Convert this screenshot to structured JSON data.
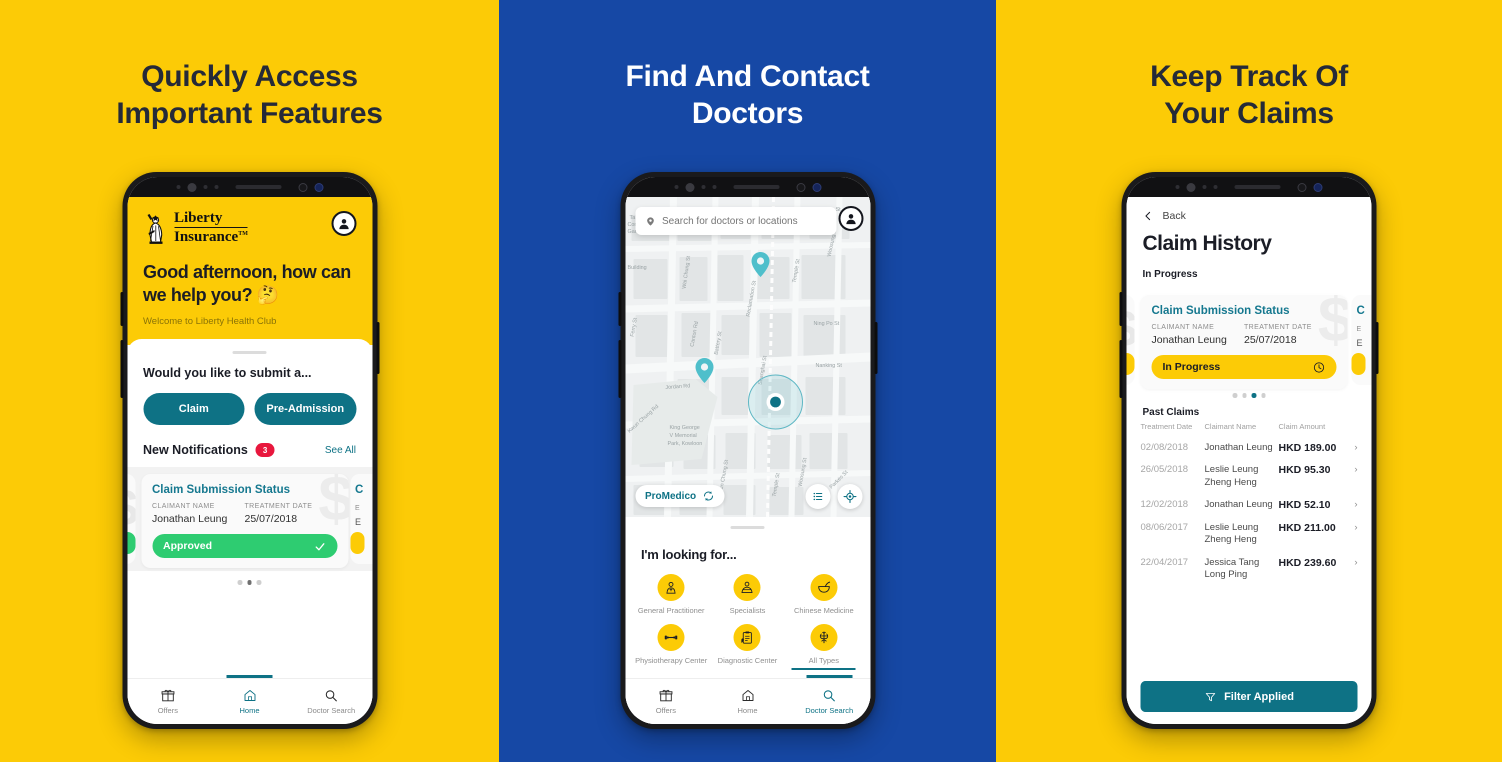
{
  "panels": [
    {
      "headline": "Quickly Access\nImportant Features",
      "bg": "#FCCB06",
      "text_color": "#252A38"
    },
    {
      "headline": "Find And Contact\nDoctors",
      "bg": "#1648A5",
      "text_color": "#FFFFFF"
    },
    {
      "headline": "Keep Track Of\nYour Claims",
      "bg": "#FCCB06",
      "text_color": "#252A38"
    }
  ],
  "colors": {
    "yellow": "#FCCB06",
    "blue": "#1648A5",
    "teal": "#0E7285",
    "teal_text": "#15788F",
    "green": "#2ECC71",
    "red_badge": "#E8173D",
    "dark": "#1B1D26"
  },
  "home": {
    "logo": {
      "line1": "Liberty",
      "line2": "Insurance",
      "tm": "TM",
      "icon": "statue-of-liberty-icon"
    },
    "avatar_icon": "account-circle-icon",
    "greeting": "Good afternoon, how can we help you? 🤔",
    "welcome": "Welcome to Liberty Health Club",
    "submit_prompt": "Would you like to submit a...",
    "cta": [
      {
        "label": "Claim"
      },
      {
        "label": "Pre-Admission"
      }
    ],
    "notifications": {
      "title": "New Notifications",
      "count": "3",
      "see_all": "See All"
    },
    "card": {
      "title": "Claim Submission Status",
      "watermark": "$",
      "label_claimant": "CLAIMANT  NAME",
      "label_treatment": "TREATMENT DATE",
      "claimant": "Jonathan Leung",
      "treatment_date": "25/07/2018",
      "status": "Approved",
      "status_icon": "check-icon"
    },
    "peek_card": {
      "title": "C",
      "lbl": "E",
      "lbl2": "E"
    },
    "dots": {
      "count": 3,
      "active": 1
    },
    "tabs": [
      {
        "label": "Offers",
        "icon": "gift-icon",
        "active": false
      },
      {
        "label": "Home",
        "icon": "home-icon",
        "active": true
      },
      {
        "label": "Doctor Search",
        "icon": "search-icon",
        "active": false
      }
    ]
  },
  "doctors": {
    "search": {
      "placeholder": "Search for doctors or locations",
      "icon": "location-pin-icon"
    },
    "avatar_icon": "account-circle-icon",
    "provider_chip": {
      "label": "ProMedico",
      "icon": "refresh-icon"
    },
    "map_buttons": [
      {
        "icon": "list-icon"
      },
      {
        "icon": "locate-icon"
      }
    ],
    "map_labels": [
      "Tai Kok Tsui Community Garden",
      "Pak Hoi St",
      "Woosung St",
      "Wai Chung St",
      "Canton Rd",
      "Battery St",
      "Reclamation St",
      "Shanghai St",
      "Temple St",
      "Ning Po St",
      "Nanking St",
      "Jordan Rd",
      "Ferry St",
      "Kwun Chung St",
      "King George V Memorial Park, Kowloon",
      "Parkes St"
    ],
    "looking_for": "I'm looking for...",
    "categories": [
      {
        "label": "General Practitioner",
        "icon": "doctor-icon",
        "selected": false
      },
      {
        "label": "Specialists",
        "icon": "specialist-icon",
        "selected": false
      },
      {
        "label": "Chinese Medicine",
        "icon": "mortar-pestle-icon",
        "selected": false
      },
      {
        "label": "Physiotherapy Center",
        "icon": "dumbbell-icon",
        "selected": false
      },
      {
        "label": "Diagnostic Center",
        "icon": "clipboard-icon",
        "selected": false
      },
      {
        "label": "All Types",
        "icon": "caduceus-icon",
        "selected": true
      }
    ],
    "tabs": [
      {
        "label": "Offers",
        "icon": "gift-icon",
        "active": false
      },
      {
        "label": "Home",
        "icon": "home-icon",
        "active": false
      },
      {
        "label": "Doctor Search",
        "icon": "search-icon",
        "active": true
      }
    ]
  },
  "claims": {
    "back": "Back",
    "back_icon": "chevron-left-icon",
    "title": "Claim History",
    "in_progress_label": "In Progress",
    "card": {
      "title": "Claim Submission Status",
      "watermark": "$",
      "label_claimant": "CLAIMANT NAME",
      "label_treatment": "TREATMENT DATE",
      "claimant": "Jonathan Leung",
      "treatment_date": "25/07/2018",
      "status": "In Progress",
      "status_icon": "clock-icon"
    },
    "peek_card": {
      "title": "C",
      "lbl": "E",
      "lbl2": "E"
    },
    "dots": {
      "count": 4,
      "active": 2
    },
    "past_claims_label": "Past Claims",
    "table": {
      "headers": [
        "Treatment Date",
        "Claimant Name",
        "Claim Amount"
      ],
      "rows": [
        {
          "date": "02/08/2018",
          "name": "Jonathan Leung",
          "amount": "HKD 189.00"
        },
        {
          "date": "26/05/2018",
          "name": "Leslie Leung Zheng Heng",
          "amount": "HKD 95.30"
        },
        {
          "date": "12/02/2018",
          "name": "Jonathan Leung",
          "amount": "HKD 52.10"
        },
        {
          "date": "08/06/2017",
          "name": "Leslie Leung Zheng Heng",
          "amount": "HKD 211.00"
        },
        {
          "date": "22/04/2017",
          "name": "Jessica Tang Long Ping",
          "amount": "HKD 239.60"
        }
      ],
      "row_chevron": "chevron-right-icon"
    },
    "filter_button": {
      "label": "Filter Applied",
      "icon": "filter-icon"
    }
  }
}
